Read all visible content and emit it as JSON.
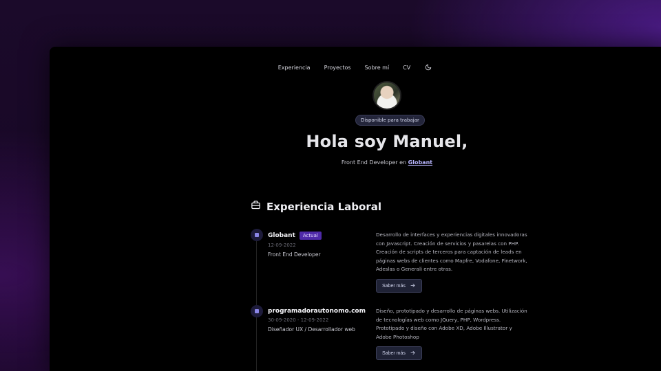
{
  "nav": {
    "items": [
      {
        "label": "Experiencia"
      },
      {
        "label": "Proyectos"
      },
      {
        "label": "Sobre mí"
      },
      {
        "label": "CV"
      }
    ],
    "theme_icon": "moon-icon"
  },
  "hero": {
    "badge": "Disponible para trabajar",
    "title": "Hola soy Manuel,",
    "subtitle_prefix": "Front End Developer en ",
    "subtitle_company": "Globant"
  },
  "experience": {
    "title": "Experiencia Laboral",
    "icon": "briefcase-icon",
    "jobs": [
      {
        "company": "Globant",
        "tag": "Actual",
        "date": "12-09-2022",
        "role": "Front End Developer",
        "description": "Desarrollo de interfaces y experiencias digitales innovadoras con Javascript. Creación de servicios y pasarelas con PHP. Creación de scripts de terceros para captación de leads en páginas webs de clientes como Mapfre, Vodafone, Finetwork, Adeslas o Generali entre otras.",
        "button": "Saber más"
      },
      {
        "company": "programadorautonomo.com",
        "date": "30-09-2020 - 12-09-2022",
        "role": "Diseñador UX / Desarrollador web",
        "description": "Diseño, prototipado y desarrollo de páginas webs. Utilización de tecnologías web como JQuery, PHP, Wordpress. Prototipado y diseño con Adobe XD, Adobe Illustrator y Adobe Photoshop",
        "button": "Saber más"
      }
    ]
  },
  "colors": {
    "accent": "#4f2aa8",
    "link": "#b9b6ff",
    "background": "#000000"
  }
}
